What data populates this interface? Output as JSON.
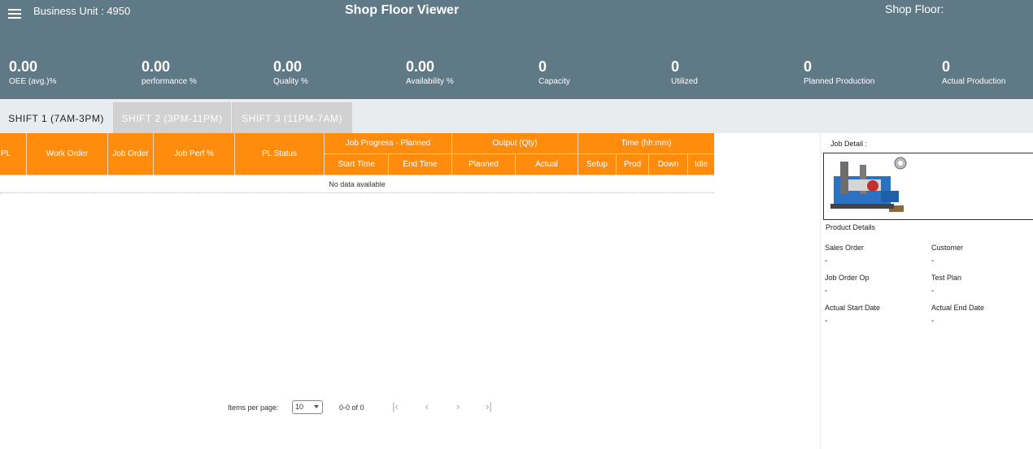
{
  "header": {
    "business_unit": "Business Unit : 4950",
    "title": "Shop Floor Viewer",
    "shop_floor": "Shop Floor:"
  },
  "kpis": [
    {
      "value": "0.00",
      "label": "OEE (avg.)%"
    },
    {
      "value": "0.00",
      "label": "performance %"
    },
    {
      "value": "0.00",
      "label": "Quality %"
    },
    {
      "value": "0.00",
      "label": "Availability %"
    },
    {
      "value": "0",
      "label": "Capacity"
    },
    {
      "value": "0",
      "label": "Utilized"
    },
    {
      "value": "0",
      "label": "Planned Production"
    },
    {
      "value": "0",
      "label": "Actual Production"
    }
  ],
  "tabs": [
    {
      "label": "SHIFT 1 (7AM-3PM)"
    },
    {
      "label": "SHIFT 2 (3PM-11PM)"
    },
    {
      "label": "SHIFT 3 (11PM-7AM)"
    }
  ],
  "table": {
    "columns": {
      "pl": "PL",
      "work_order": "Work Order",
      "job_order": "Job Order",
      "job_perf": "Job Perf %",
      "pl_status": "PL Status",
      "job_progress": "Job Progress - Planned",
      "start_time": "Start Time",
      "end_time": "End Time",
      "output": "Output (Qty)",
      "planned": "Planned",
      "actual": "Actual",
      "time": "Time (hh:mm)",
      "setup": "Setup",
      "prod": "Prod",
      "down": "Down",
      "idle": "Idle"
    },
    "empty_message": "No data available"
  },
  "paginator": {
    "items_per_page_label": "Items per page:",
    "page_size": "10",
    "range": "0-0 of 0"
  },
  "job_detail": {
    "title": "Job Detail :",
    "product_details_title": "Product Details",
    "fields": {
      "sales_order": {
        "label": "Sales Order",
        "value": "-"
      },
      "customer": {
        "label": "Customer",
        "value": "-"
      },
      "job_order_op": {
        "label": "Job Order Op",
        "value": "-"
      },
      "test_plan": {
        "label": "Test Plan",
        "value": "-"
      },
      "actual_start_date": {
        "label": "Actual Start Date",
        "value": "-"
      },
      "actual_end_date": {
        "label": "Actual End Date",
        "value": "-"
      }
    }
  },
  "colors": {
    "header_bg": "#5f7987",
    "grid_header_bg": "#ff8c0d",
    "tab_bar_bg": "#e8ecee"
  }
}
